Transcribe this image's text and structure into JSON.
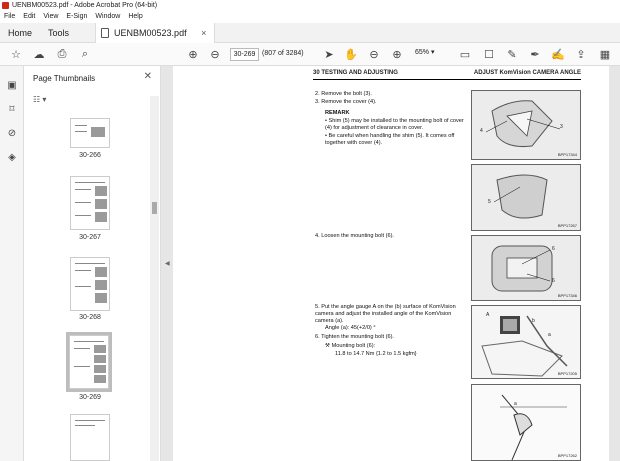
{
  "window": {
    "title": "UENBM00523.pdf - Adobe Acrobat Pro (64-bit)"
  },
  "menu": [
    "File",
    "Edit",
    "View",
    "E-Sign",
    "Window",
    "Help"
  ],
  "tabs": {
    "home": "Home",
    "tools": "Tools",
    "document": "UENBM00523.pdf",
    "close": "×"
  },
  "toolbar": {
    "page_value": "30-269",
    "page_count": "(807 of 3284)",
    "zoom": "65%"
  },
  "sidebar": {
    "title": "Page Thumbnails",
    "thumbnails": [
      {
        "label": "30-266"
      },
      {
        "label": "30-267"
      },
      {
        "label": "30-268"
      },
      {
        "label": "30-269"
      }
    ]
  },
  "page": {
    "header_left": "30 TESTING AND ADJUSTING",
    "header_right": "ADJUST KomVision CAMERA ANGLE",
    "step2": "2.     Remove the bolt (3).",
    "step3": "3.     Remove the cover (4).",
    "remark": "REMARK",
    "remark1": "•  Shim (5) may be installed to the mounting bolt of cover (4) for adjustment of clearance in cover.",
    "remark2": "•  Be careful when handling the shim (5). It comes off together with cover (4).",
    "step4": "4.     Loosen the mounting bolt (6).",
    "step5": "5.     Put the angle gauge A on the (b) surface of KomVision camera and adjust the installed angle of the KomVision camera (a).",
    "angle": "Angle (a): 45(+2/0) °",
    "step6": "6.     Tighten the mounting bolt (6).",
    "torque_label": "Mounting bolt (6):",
    "torque_value": "11.8 to 14.7 Nm {1.2 to 1.5 kgfm}",
    "figures": [
      {
        "code": "BPP17344",
        "labels": [
          "4",
          "3"
        ]
      },
      {
        "code": "BPP17267",
        "labels": [
          "5"
        ]
      },
      {
        "code": "BPP17346",
        "labels": [
          "6",
          "6"
        ]
      },
      {
        "code": "BPP17205",
        "labels": [
          "A",
          "b",
          "a"
        ]
      },
      {
        "code": "BPP17262",
        "labels": [
          "a"
        ]
      }
    ]
  }
}
